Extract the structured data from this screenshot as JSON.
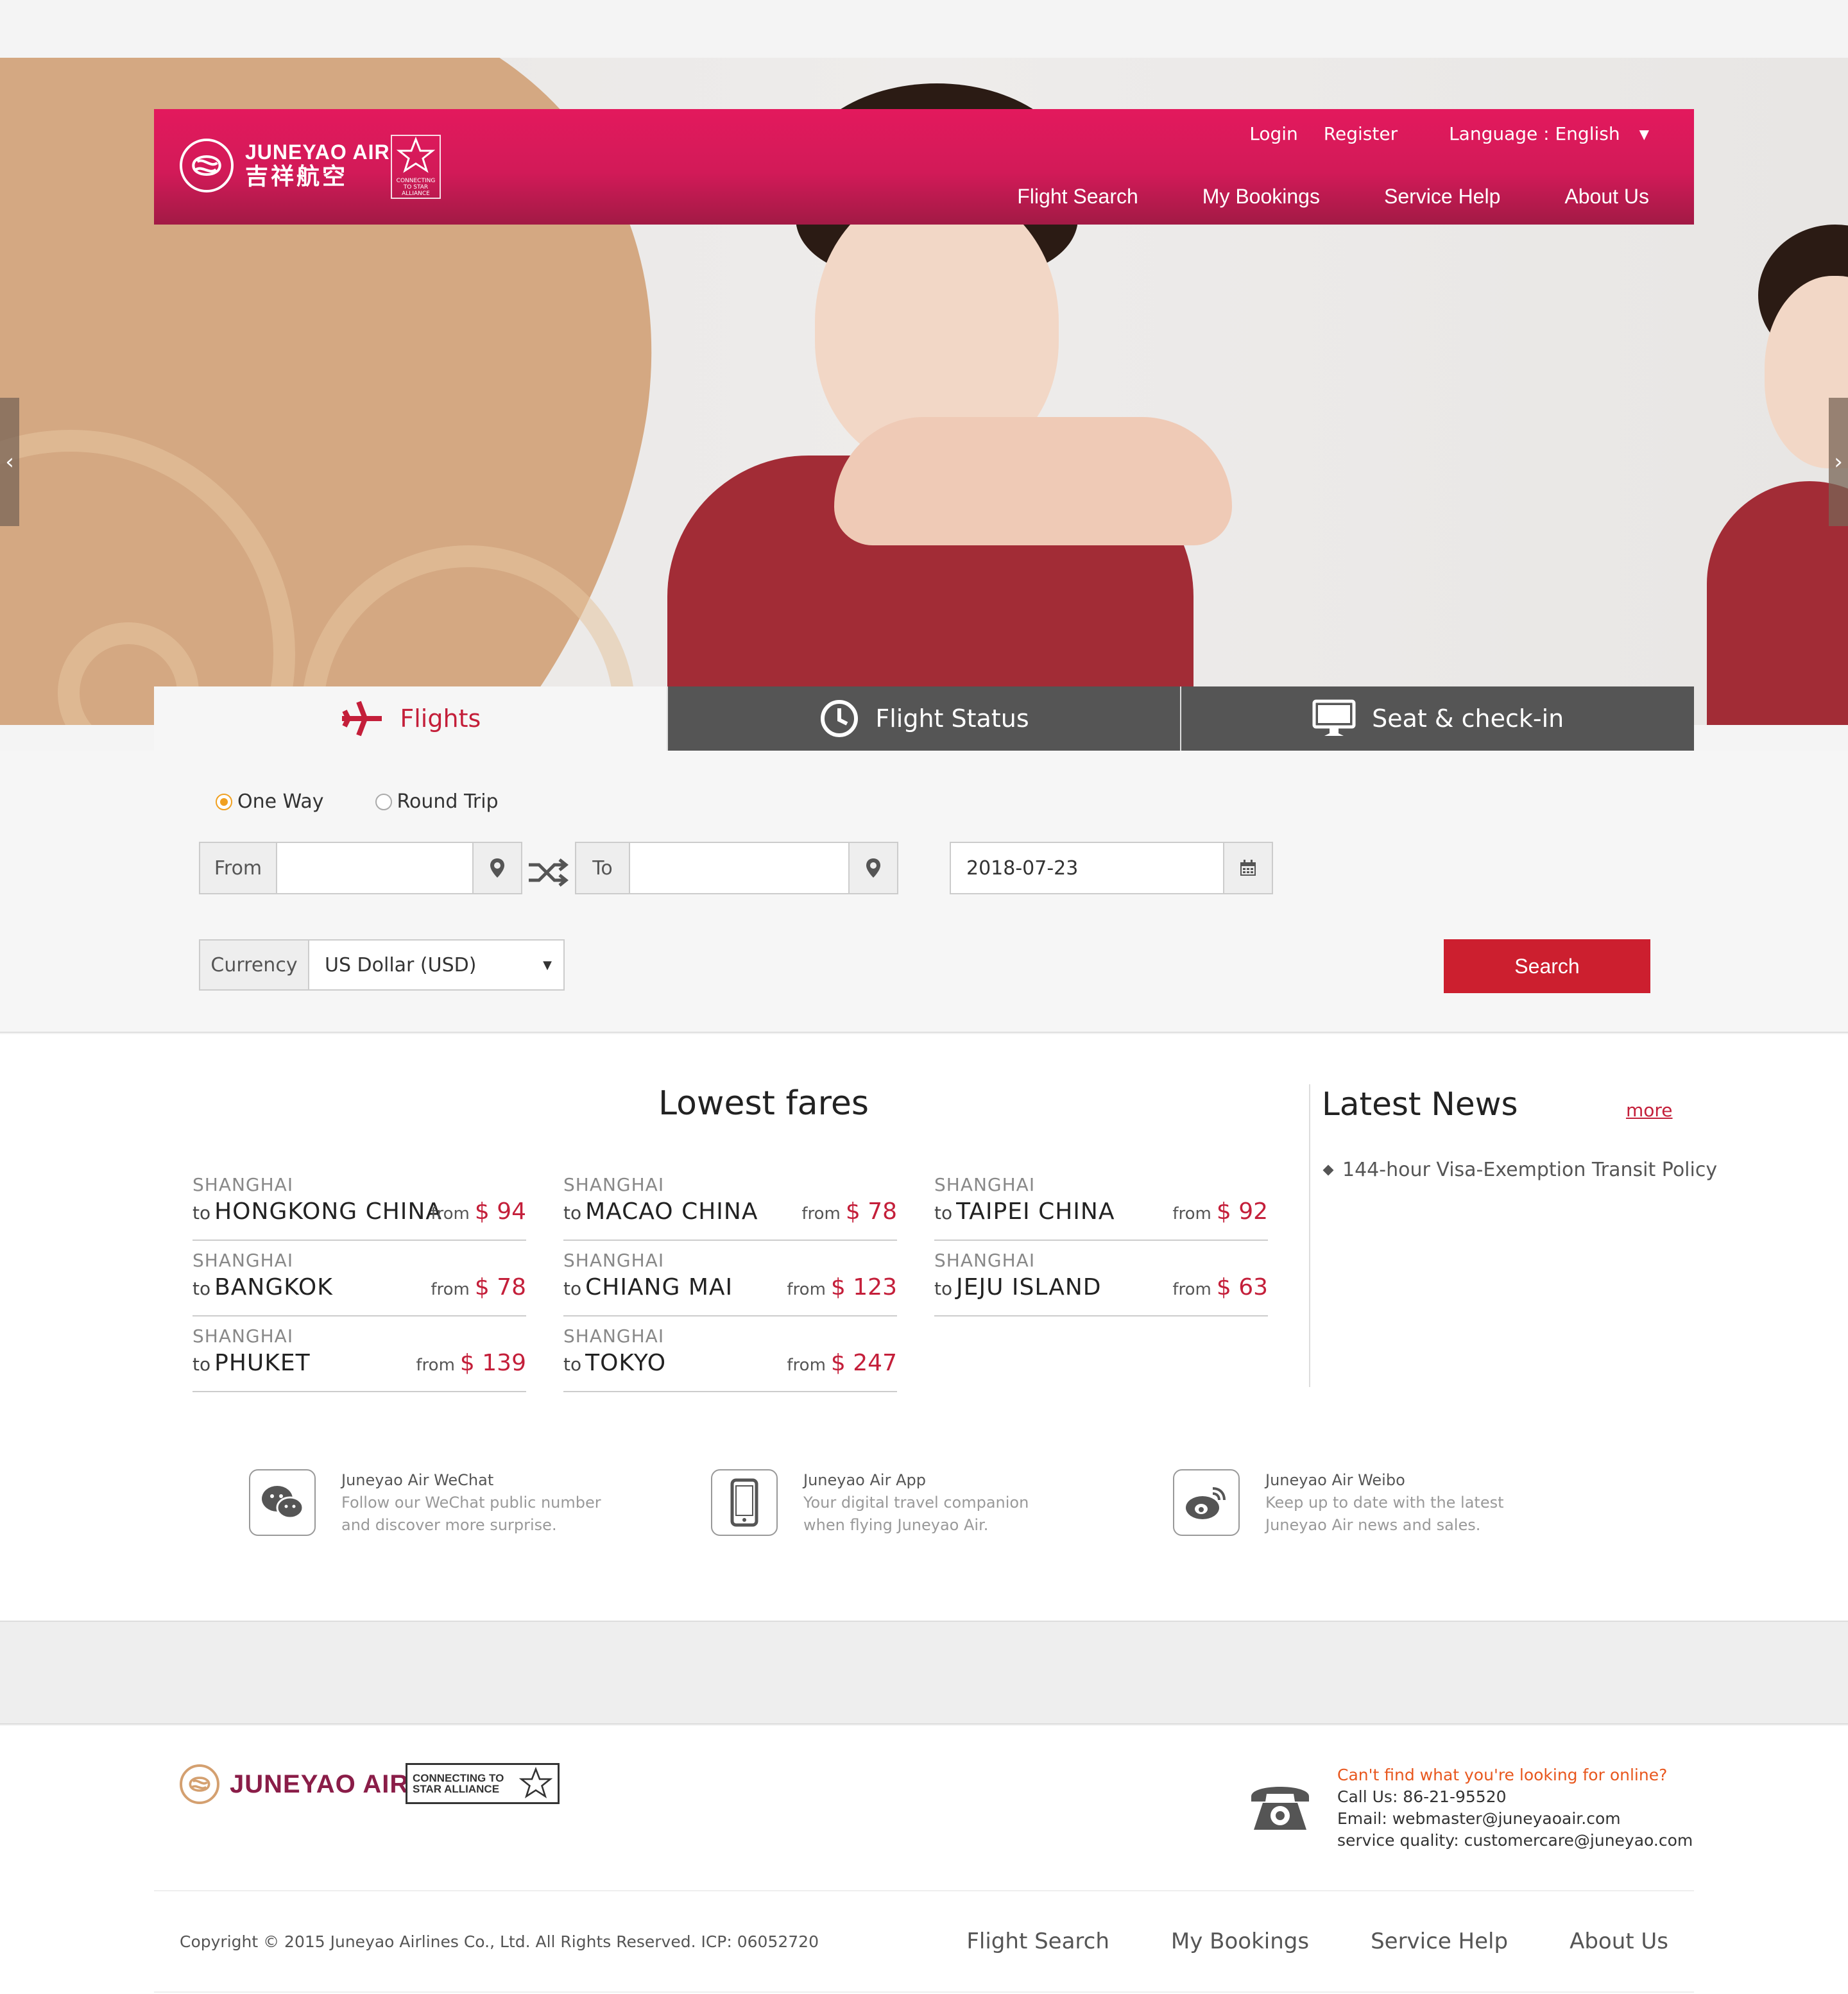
{
  "header": {
    "logo_en": "JUNEYAO AIR",
    "logo_cn": "吉祥航空",
    "alliance_label": "CONNECTING TO STAR ALLIANCE",
    "login": "Login",
    "register": "Register",
    "language": "Language : English",
    "nav": [
      "Flight Search",
      "My Bookings",
      "Service Help",
      "About Us"
    ]
  },
  "tabs": [
    {
      "label": "Flights",
      "icon": "plane-icon",
      "active": true
    },
    {
      "label": "Flight Status",
      "icon": "clock-icon",
      "active": false
    },
    {
      "label": "Seat & check-in",
      "icon": "monitor-icon",
      "active": false
    }
  ],
  "search": {
    "trip_types": [
      "One Way",
      "Round Trip"
    ],
    "selected_trip": "One Way",
    "from_label": "From",
    "from_value": "",
    "to_label": "To",
    "to_value": "",
    "date": "2018-07-23",
    "currency_label": "Currency",
    "currency_value": "US Dollar (USD)",
    "button": "Search"
  },
  "lowest_fares": {
    "title": "Lowest fares",
    "from_word": "from",
    "to_word": "to",
    "currency_symbol": "$",
    "items": [
      {
        "origin": "SHANGHAI",
        "dest": "HONGKONG CHINA",
        "price": "94"
      },
      {
        "origin": "SHANGHAI",
        "dest": "MACAO CHINA",
        "price": "78"
      },
      {
        "origin": "SHANGHAI",
        "dest": "TAIPEI CHINA",
        "price": "92"
      },
      {
        "origin": "SHANGHAI",
        "dest": "BANGKOK",
        "price": "78"
      },
      {
        "origin": "SHANGHAI",
        "dest": "CHIANG MAI",
        "price": "123"
      },
      {
        "origin": "SHANGHAI",
        "dest": "JEJU ISLAND",
        "price": "63"
      },
      {
        "origin": "SHANGHAI",
        "dest": "PHUKET",
        "price": "139"
      },
      {
        "origin": "SHANGHAI",
        "dest": "TOKYO",
        "price": "247"
      }
    ]
  },
  "news": {
    "title": "Latest News",
    "more": "more",
    "items": [
      "144-hour Visa-Exemption Transit Policy"
    ]
  },
  "social": [
    {
      "title": "Juneyao Air WeChat",
      "line1": "Follow our WeChat public number",
      "line2": "and discover more surprise.",
      "icon": "wechat-icon"
    },
    {
      "title": "Juneyao Air App",
      "line1": "Your digital travel companion",
      "line2": "when flying Juneyao Air.",
      "icon": "phone-app-icon"
    },
    {
      "title": "Juneyao Air Weibo",
      "line1": "Keep up to date with the latest",
      "line2": "Juneyao Air news and sales.",
      "icon": "weibo-icon"
    }
  ],
  "footer": {
    "logo_name": "JUNEYAO AIR",
    "alliance_line1": "CONNECTING TO",
    "alliance_line2": "STAR ALLIANCE",
    "contact_heading": "Can't find what you're looking for online?",
    "call": "Call Us: 86-21-95520",
    "email": "Email:  webmaster@juneyaoair.com",
    "service": "service quality:  customercare@juneyao.com",
    "copyright": "Copyright © 2015 Juneyao Airlines Co., Ltd. All Rights Reserved. ICP: 06052720",
    "nav": [
      "Flight Search",
      "My Bookings",
      "Service Help",
      "About Us"
    ]
  },
  "colors": {
    "brand": "#d21a58",
    "accent_red": "#c41f3a",
    "search_button": "#cc1f2f",
    "tab_inactive": "#555555"
  }
}
